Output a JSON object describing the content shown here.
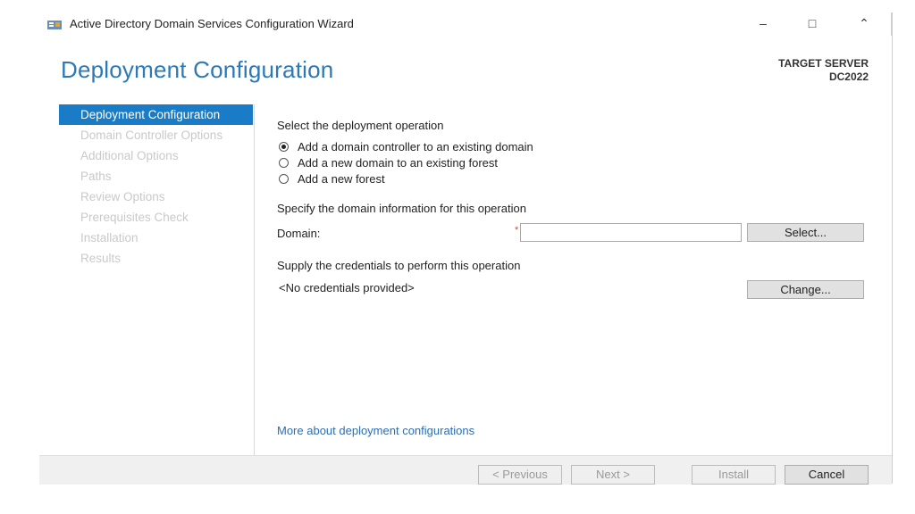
{
  "window": {
    "title": "Active Directory Domain Services Configuration Wizard",
    "controls": {
      "minimize": "–",
      "maximize": "□",
      "close": "⌃"
    }
  },
  "header": {
    "page_title": "Deployment Configuration",
    "target_label": "TARGET SERVER",
    "target_name": "DC2022"
  },
  "nav": {
    "items": [
      {
        "label": "Deployment Configuration",
        "active": true
      },
      {
        "label": "Domain Controller Options",
        "active": false
      },
      {
        "label": "Additional Options",
        "active": false
      },
      {
        "label": "Paths",
        "active": false
      },
      {
        "label": "Review Options",
        "active": false
      },
      {
        "label": "Prerequisites Check",
        "active": false
      },
      {
        "label": "Installation",
        "active": false
      },
      {
        "label": "Results",
        "active": false
      }
    ]
  },
  "content": {
    "operation_label": "Select the deployment operation",
    "operations": [
      {
        "label": "Add a domain controller to an existing domain",
        "selected": true
      },
      {
        "label": "Add a new domain to an existing forest",
        "selected": false
      },
      {
        "label": "Add a new forest",
        "selected": false
      }
    ],
    "domain_info_label": "Specify the domain information for this operation",
    "domain_label": "Domain:",
    "domain_required_marker": "*",
    "domain_value": "",
    "select_button": "Select...",
    "credentials_label": "Supply the credentials to perform this operation",
    "credentials_status": "<No credentials provided>",
    "change_button": "Change...",
    "more_link": "More about deployment configurations"
  },
  "footer": {
    "previous": "< Previous",
    "next": "Next >",
    "install": "Install",
    "cancel": "Cancel"
  },
  "colors": {
    "accent": "#1a7bc7",
    "title": "#2d79b6",
    "link": "#2a6fb5"
  }
}
